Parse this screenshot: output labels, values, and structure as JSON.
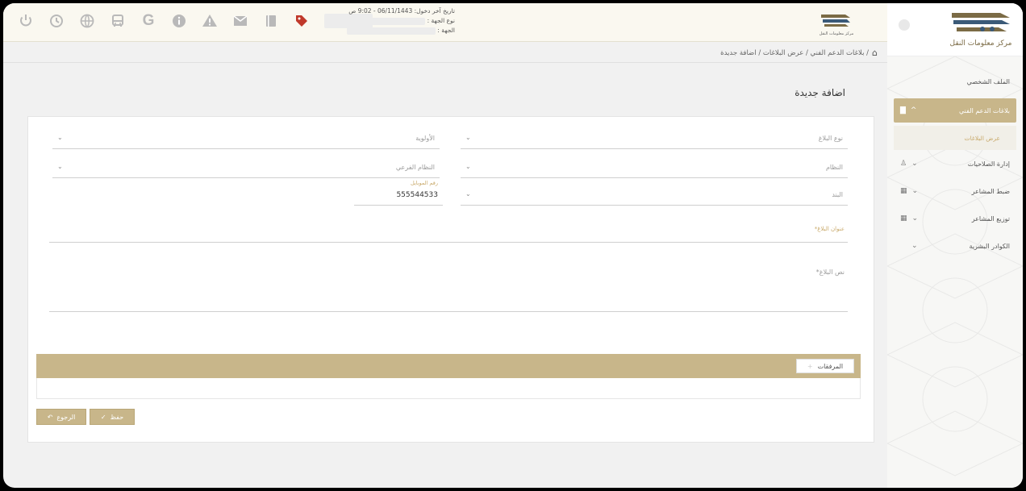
{
  "header": {
    "last_login": "تاريخ آخر دخول: 06/11/1443 - 9:02 ص",
    "entity_type_label": "نوع الجهة :",
    "entity_label": "الجهة :",
    "icons": [
      "power-icon",
      "history-icon",
      "globe-icon",
      "bus-icon",
      "google-icon",
      "info-icon",
      "warning-icon",
      "mail-icon",
      "card-icon",
      "tag-icon"
    ],
    "small_logo_text": "مركز معلومات النقل"
  },
  "sidebar": {
    "logo_text": "مركز معلومات النقل",
    "items": [
      {
        "label": "الملف الشخصي",
        "icon": "",
        "expand": ""
      },
      {
        "label": "بلاغات الدعم الفني",
        "icon": "message-icon",
        "expand": "^",
        "active": true
      },
      {
        "label": "إدارة الصلاحيات",
        "icon": "user-icon",
        "expand": "⌄"
      },
      {
        "label": "ضبط المشاعر",
        "icon": "grid-icon",
        "expand": "⌄"
      },
      {
        "label": "توزيع المشاعر",
        "icon": "grid-icon",
        "expand": "⌄"
      },
      {
        "label": "الكوادر البشرية",
        "icon": "",
        "expand": "⌄"
      }
    ],
    "sub_item": "عرض البلاغات"
  },
  "breadcrumb": {
    "text": "/ بلاغات الدعم الفني / عرض البلاغات / اضافة جديدة"
  },
  "page_title": "اضافة جديدة",
  "form": {
    "report_type": "نوع البلاغ",
    "priority": "الأولوية",
    "system": "النظام",
    "subsystem": "النظام الفرعي",
    "item": "البند",
    "mobile_label": "رقم الموبايل",
    "mobile_value": "555544533",
    "subject_label": "عنوان البلاغ*",
    "body_label": "نص البلاغ*"
  },
  "attachments": {
    "label": "المرفقات",
    "add": "+"
  },
  "buttons": {
    "save": "حفظ",
    "back": "الرجوع"
  },
  "colors": {
    "accent": "#c8b68a",
    "accent_text": "#c8a96a"
  }
}
